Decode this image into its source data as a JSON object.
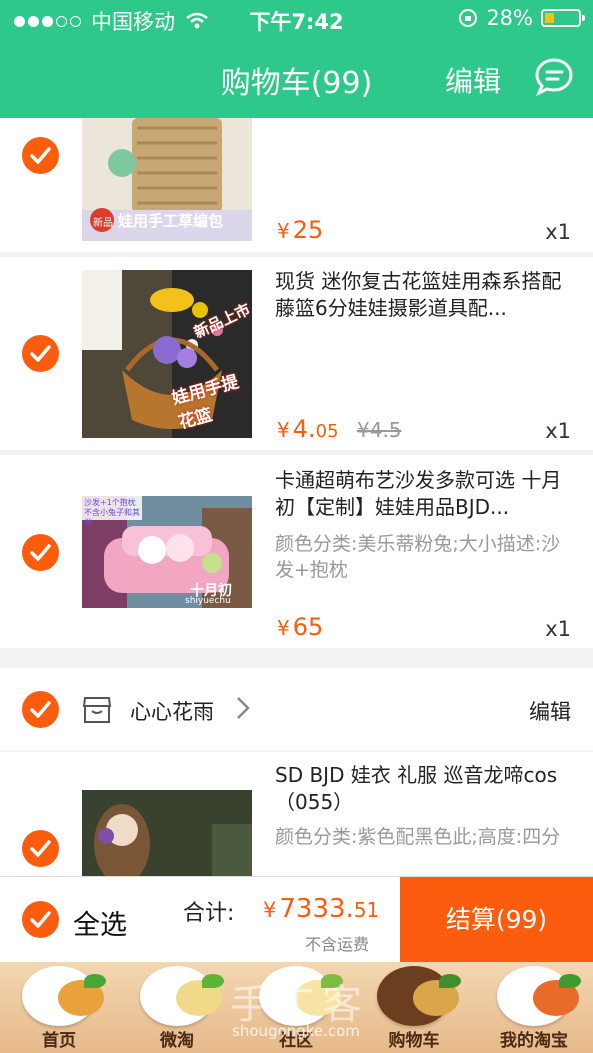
{
  "status_bar": {
    "carrier": "中国移动",
    "time": "下午7:42",
    "battery": "28%"
  },
  "header": {
    "title": "购物车(99)",
    "edit": "编辑"
  },
  "items": [
    {
      "title": "",
      "sku": "",
      "price": "25",
      "price_decimal": "",
      "old_price": "",
      "qty": "x1",
      "thumb_caption": "娃用手工草编包",
      "thumb_badge": "新品"
    },
    {
      "title": "现货 迷你复古花篮娃用森系搭配藤篮6分娃娃摄影道具配...",
      "sku": "",
      "price": "4.",
      "price_decimal": "05",
      "old_price": "¥4.5",
      "qty": "x1",
      "thumb_caption": "娃用手提花篮",
      "thumb_badge": "新品上市"
    },
    {
      "title": "卡通超萌布艺沙发多款可选 十月初【定制】娃娃用品BJD...",
      "sku": "颜色分类:美乐蒂粉兔;大小描述:沙发+抱枕",
      "price": "65",
      "price_decimal": "",
      "old_price": "",
      "qty": "x1",
      "thumb_caption": "十月初",
      "thumb_caption2": "shiyuechu",
      "thumb_badge": "沙发+1个抱枕 不含小兔子和其他"
    },
    {
      "title": "SD  BJD 娃衣 礼服 巡音龙啼cos （055）",
      "sku": "颜色分类:紫色配黑色此;高度:四分",
      "price": "",
      "price_decimal": "",
      "old_price": "",
      "qty": ""
    }
  ],
  "shop": {
    "name": "心心花雨",
    "edit": "编辑"
  },
  "checkout": {
    "select_all": "全选",
    "total_label": "合计:",
    "currency": "¥",
    "total": "7333.",
    "total_decimal": "51",
    "shipping_note": "不含运费",
    "settle": "结算(99)"
  },
  "tabs": [
    {
      "label": "首页"
    },
    {
      "label": "微淘"
    },
    {
      "label": "社区"
    },
    {
      "label": "购物车"
    },
    {
      "label": "我的淘宝"
    }
  ],
  "watermark": {
    "text": "手工客",
    "url": "shougongke.com"
  },
  "colors": {
    "brand_green": "#2ec88a",
    "accent_orange": "#fc5c0e"
  },
  "icons": [
    "signal-icon",
    "wifi-icon",
    "rotation-lock-icon",
    "battery-icon",
    "message-icon",
    "check-icon",
    "store-icon",
    "chevron-right-icon"
  ]
}
